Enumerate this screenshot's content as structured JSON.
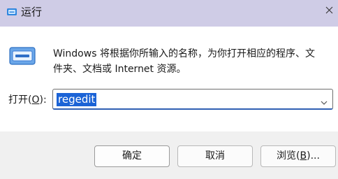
{
  "window": {
    "title": "运行",
    "titlebar_color": "#cfcce6",
    "icons": {
      "app": "run-app-icon",
      "close": "close-icon",
      "main": "run-window-icon",
      "dropdown": "chevron-down-icon"
    }
  },
  "main": {
    "description_line1": "Windows 将根据你所输入的名称，为你打开相应的程序、文",
    "description_line2": "件夹、文档或 Internet 资源。",
    "open_label_prefix": "打开(",
    "open_label_key": "O",
    "open_label_suffix": "):",
    "input_value": "regedit"
  },
  "buttons": {
    "ok": "确定",
    "cancel": "取消",
    "browse_prefix": "浏览(",
    "browse_key": "B",
    "browse_suffix": ")..."
  },
  "colors": {
    "selection": "#1b63d6",
    "focus_border": "#2f5fb3",
    "footer_bg": "#f0f0f0"
  }
}
